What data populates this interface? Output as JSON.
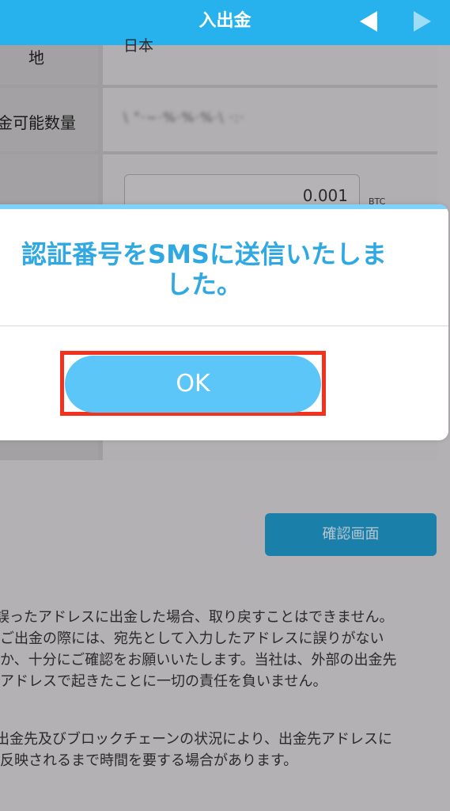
{
  "header": {
    "title": "入出金",
    "prev_icon": "caret-left-icon",
    "next_icon": "caret-right-icon"
  },
  "form": {
    "rows": [
      {
        "label": "地",
        "value": "日本"
      },
      {
        "label": "金可能数量",
        "value": "\\ \"·~·%·%·%·\\ ·:·"
      },
      {
        "label": "",
        "value": ""
      }
    ],
    "amount_value": "0.001",
    "amount_unit": "BTC"
  },
  "confirm_button_label": "確認画面",
  "notes": [
    "誤ったアドレスに出金した場合、取り戻すことはできません。ご出金の際には、宛先として入力したアドレスに誤りがないか、十分にご確認をお願いいたします。当社は、外部の出金先アドレスで起きたことに一切の責任を負いません。",
    "出金先及びブロックチェーンの状況により、出金先アドレスに反映されるまで時間を要する場合があります。"
  ],
  "dialog": {
    "message_line1": "認証番号をSMSに送信いたしま",
    "message_line2": "した。",
    "ok_label": "OK",
    "highlight_color": "#f2321e"
  },
  "colors": {
    "brand": "#27b2ee",
    "dialog_text": "#30a9e2",
    "ok_button": "#5dc6f9",
    "confirm_button": "#1a7fa9"
  }
}
